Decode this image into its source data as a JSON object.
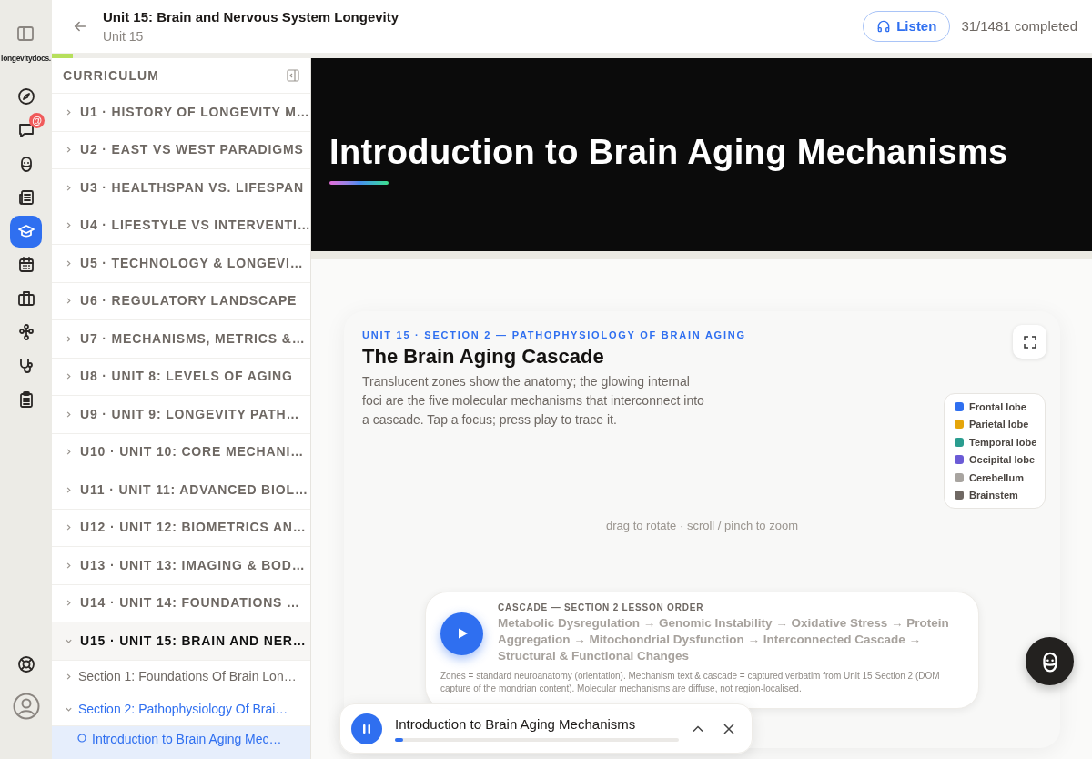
{
  "rail": {
    "logo": "longevitydocs.",
    "badge": "@",
    "items": [
      {
        "kind": "compass",
        "selected": false
      },
      {
        "kind": "chat",
        "selected": false
      },
      {
        "kind": "face",
        "selected": false
      },
      {
        "kind": "news",
        "selected": false
      },
      {
        "kind": "cap",
        "selected": true
      },
      {
        "kind": "calendar",
        "selected": false
      },
      {
        "kind": "briefcase",
        "selected": false
      },
      {
        "kind": "nodes",
        "selected": false
      },
      {
        "kind": "stethoscope",
        "selected": false
      },
      {
        "kind": "clipboard",
        "selected": false
      }
    ]
  },
  "header": {
    "title": "Unit 15: Brain and Nervous System Longevity",
    "subtitle": "Unit 15",
    "listen": "Listen",
    "progress_text": "31/1481 completed",
    "level": 0.02
  },
  "curriculum": {
    "title": "CURRICULUM",
    "units": [
      {
        "label": "U1 · HISTORY OF LONGEVITY M…",
        "expanded": false,
        "selected": false
      },
      {
        "label": "U2 · EAST VS WEST PARADIGMS",
        "expanded": false,
        "selected": false
      },
      {
        "label": "U3 · HEALTHSPAN VS. LIFESPAN",
        "expanded": false,
        "selected": false
      },
      {
        "label": "U4 · LIFESTYLE VS INTERVENTI…",
        "expanded": false,
        "selected": false
      },
      {
        "label": "U5 · TECHNOLOGY & LONGEVI…",
        "expanded": false,
        "selected": false
      },
      {
        "label": "U6 · REGULATORY LANDSCAPE",
        "expanded": false,
        "selected": false
      },
      {
        "label": "U7 · MECHANISMS, METRICS &…",
        "expanded": false,
        "selected": false
      },
      {
        "label": "U8 · UNIT 8: LEVELS OF AGING",
        "expanded": false,
        "selected": false
      },
      {
        "label": "U9 · UNIT 9: LONGEVITY PATH…",
        "expanded": false,
        "selected": false
      },
      {
        "label": "U10 · UNIT 10: CORE MECHANI…",
        "expanded": false,
        "selected": false
      },
      {
        "label": "U11 · UNIT 11: ADVANCED BIOL…",
        "expanded": false,
        "selected": false
      },
      {
        "label": "U12 · UNIT 12: BIOMETRICS AN…",
        "expanded": false,
        "selected": false
      },
      {
        "label": "U13 · UNIT 13: IMAGING & BOD…",
        "expanded": false,
        "selected": false
      },
      {
        "label": "U14 · UNIT 14: FOUNDATIONS …",
        "expanded": false,
        "selected": false
      },
      {
        "label": "U15 · UNIT 15: BRAIN AND NER…",
        "expanded": true,
        "selected": true,
        "children": [
          {
            "label": "Section 1: Foundations Of Brain Lon…",
            "expanded": false,
            "selected": false
          },
          {
            "label": "Section 2: Pathophysiology Of Brai…",
            "expanded": true,
            "selected": true,
            "children": [
              {
                "label": "Introduction to Brain Aging Mec…",
                "selected": true
              }
            ]
          }
        ]
      }
    ]
  },
  "hero": {
    "title": "Introduction to Brain Aging Mechanisms"
  },
  "card": {
    "eyebrow": "UNIT 15 · SECTION 2 — PATHOPHYSIOLOGY OF BRAIN AGING",
    "title": "The Brain Aging Cascade",
    "description": "Translucent zones show the anatomy; the glowing internal foci are the five molecular mechanisms that interconnect into a cascade. Tap a focus; press play to trace it.",
    "hint": "drag to rotate · scroll / pinch to zoom",
    "legend": [
      {
        "label": "Frontal lobe",
        "color": "#2f6ff0"
      },
      {
        "label": "Parietal lobe",
        "color": "#e5a50a"
      },
      {
        "label": "Temporal lobe",
        "color": "#2a9d8f"
      },
      {
        "label": "Occipital lobe",
        "color": "#6b5bd6"
      },
      {
        "label": "Cerebellum",
        "color": "#a8a4a0"
      },
      {
        "label": "Brainstem",
        "color": "#6f6863"
      }
    ],
    "cascade": {
      "label": "CASCADE — SECTION 2 LESSON ORDER",
      "sequence": "Metabolic Dysregulation → Genomic Instability → Oxidative Stress → Protein Aggregation → Mitochondrial Dysfunction → Interconnected Cascade → Structural & Functional Changes",
      "note": "Zones = standard neuroanatomy (orientation). Mechanism text & cascade = captured verbatim from Unit 15 Section 2 (DOM capture of the mondrian content). Molecular mechanisms are diffuse, not region-localised."
    }
  },
  "player": {
    "title": "Introduction to Brain Aging Mechanisms",
    "playing": true,
    "level": 0.03
  }
}
